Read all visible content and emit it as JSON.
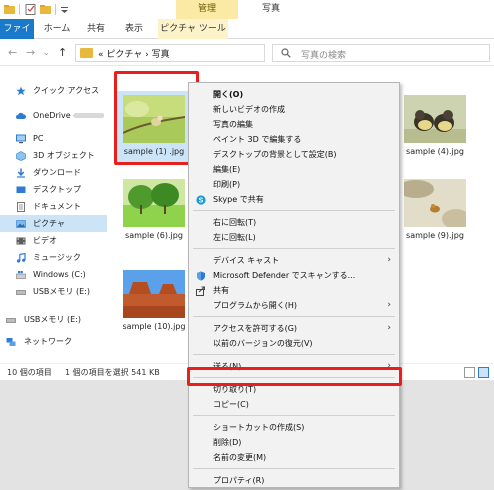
{
  "title_bar": {
    "context_tab": "管理",
    "window_title": "写真"
  },
  "ribbon": {
    "tabs": [
      "ファイル",
      "ホーム",
      "共有",
      "表示",
      "ピクチャ ツール"
    ]
  },
  "address": {
    "path": "« ピクチャ › 写真",
    "search_placeholder": "写真の検索"
  },
  "nav": {
    "items": [
      {
        "label": "クイック アクセス",
        "icon": "star-icon"
      },
      {
        "label": "OneDrive -",
        "icon": "cloud-icon"
      },
      {
        "label": "PC",
        "icon": "pc-icon"
      },
      {
        "label": "3D オブジェクト",
        "icon": "cube-icon"
      },
      {
        "label": "ダウンロード",
        "icon": "download-icon"
      },
      {
        "label": "デスクトップ",
        "icon": "desktop-icon"
      },
      {
        "label": "ドキュメント",
        "icon": "document-icon"
      },
      {
        "label": "ピクチャ",
        "icon": "picture-icon"
      },
      {
        "label": "ビデオ",
        "icon": "video-icon"
      },
      {
        "label": "ミュージック",
        "icon": "music-icon"
      },
      {
        "label": "Windows (C:)",
        "icon": "drive-icon"
      },
      {
        "label": "USBメモリ (E:)",
        "icon": "usb-icon"
      },
      {
        "label": "USBメモリ (E:)",
        "icon": "usb-icon"
      },
      {
        "label": "ネットワーク",
        "icon": "network-icon"
      }
    ]
  },
  "files": [
    {
      "name": "sample (1) .jpg",
      "selected": true
    },
    {
      "name": "sample (4).jpg",
      "selected": false
    },
    {
      "name": "sample (6).jpg",
      "selected": false
    },
    {
      "name": "sample (9).jpg",
      "selected": false
    },
    {
      "name": "sample (10).jpg",
      "selected": false
    }
  ],
  "status": {
    "count": "10 個の項目",
    "selection": "1 個の項目を選択 541 KB"
  },
  "context_menu": {
    "items": [
      {
        "label": "開く(O)",
        "bold": true
      },
      {
        "label": "新しいビデオの作成"
      },
      {
        "label": "写真の編集"
      },
      {
        "label": "ペイント 3D で編集する"
      },
      {
        "label": "デスクトップの背景として設定(B)"
      },
      {
        "label": "編集(E)"
      },
      {
        "label": "印刷(P)"
      },
      {
        "label": "Skype で共有",
        "icon": "skype-icon"
      },
      {
        "label": "右に回転(T)"
      },
      {
        "label": "左に回転(L)"
      },
      {
        "label": "デバイス キャスト",
        "submenu": true
      },
      {
        "label": "Microsoft Defender でスキャンする...",
        "icon": "defender-icon"
      },
      {
        "label": "共有",
        "icon": "share-icon"
      },
      {
        "label": "プログラムから開く(H)",
        "submenu": true
      },
      {
        "label": "アクセスを許可する(G)",
        "submenu": true
      },
      {
        "label": "以前のバージョンの復元(V)"
      },
      {
        "label": "送る(N)",
        "submenu": true
      },
      {
        "label": "切り取り(T)"
      },
      {
        "label": "コピー(C)",
        "highlighted": true
      },
      {
        "label": "ショートカットの作成(S)"
      },
      {
        "label": "削除(D)"
      },
      {
        "label": "名前の変更(M)"
      },
      {
        "label": "プロパティ(R)"
      }
    ]
  },
  "colors": {
    "accent": "#1979ca",
    "highlight_frame": "#e8201c",
    "selection": "#cce4f7",
    "picture_tools_tab": "#fbe9a6"
  }
}
